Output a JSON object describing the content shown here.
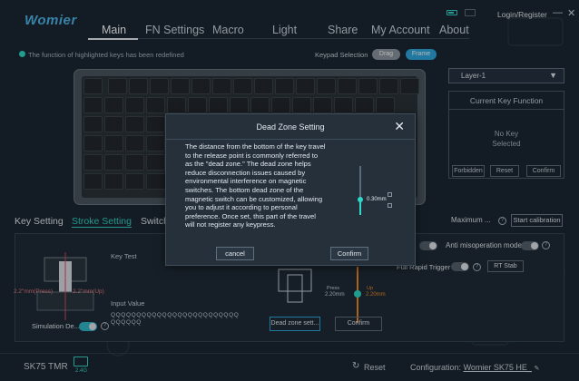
{
  "app": {
    "logo": "Womier",
    "login_label": "Login/Register",
    "window_controls": {
      "minimize": "—",
      "close": "✕"
    }
  },
  "nav": {
    "items": [
      "Main",
      "FN Settings",
      "Macro",
      "Light",
      "Share",
      "My Account",
      "About"
    ],
    "active": "Main"
  },
  "hint": {
    "text": "The function of highlighted keys has been redefined"
  },
  "keypad": {
    "label": "Keypad Selection",
    "options": [
      "Drag",
      "Frame"
    ],
    "selected": "Frame"
  },
  "layer": {
    "value": "Layer-1"
  },
  "current_key_function": {
    "title": "Current Key Function",
    "line1": "No Key",
    "line2": "Selected",
    "buttons": [
      "Forbidden",
      "Reset",
      "Confirm"
    ]
  },
  "sub_tabs": [
    "Key Setting",
    "Stroke Setting",
    "Switch"
  ],
  "sub_tab_active": "Stroke Setting",
  "max_button": "Maximum ...",
  "calibration_button": "Start calibration",
  "stroke": {
    "press_label": "2.2\"mm(Press)",
    "up_label": "2.2\"mm(Up)",
    "key_test_label": "Key Test",
    "input_value_label": "Input Value",
    "input_value_line1": "QQQQQQQQQQQQQQQQQQQQQQQQQ",
    "input_value_line2": "QQQQQQ",
    "simulation_label": "Simulation De...",
    "anti_label": "Anti misoperation mode",
    "rapid_label": "Full Rapid Trigger",
    "rt_button": "RT Stab",
    "press_small": "Press",
    "press_val": "2.20mm",
    "up_small": "Up",
    "up_val": "2.20mm",
    "dead_zone_button": "Dead zone sett...",
    "confirm_button": "Confirm"
  },
  "footer": {
    "model": "SK75 TMR",
    "connection": "2.4G",
    "reset_label": "Reset",
    "config_label": "Configuration:",
    "config_value": "Womier SK75 HE_"
  },
  "dialog": {
    "title": "Dead Zone Setting",
    "body": "The distance from the bottom of the key travel to the release point is commonly referred to as the \"dead zone.\" The dead zone helps reduce disconnection issues caused by environmental interference on magnetic switches. The bottom dead zone of the magnetic switch can be customized, allowing you to adjust it according to personal preference. Once set, this part of the travel will not register any keypress.",
    "slider_value": "0.30mm",
    "cancel_label": "cancel",
    "confirm_label": "Confirm"
  },
  "colors": {
    "accent": "#35d0c3",
    "background": "#1b2733",
    "dialog": "#25303b",
    "key_legend": "#e37a7a"
  }
}
